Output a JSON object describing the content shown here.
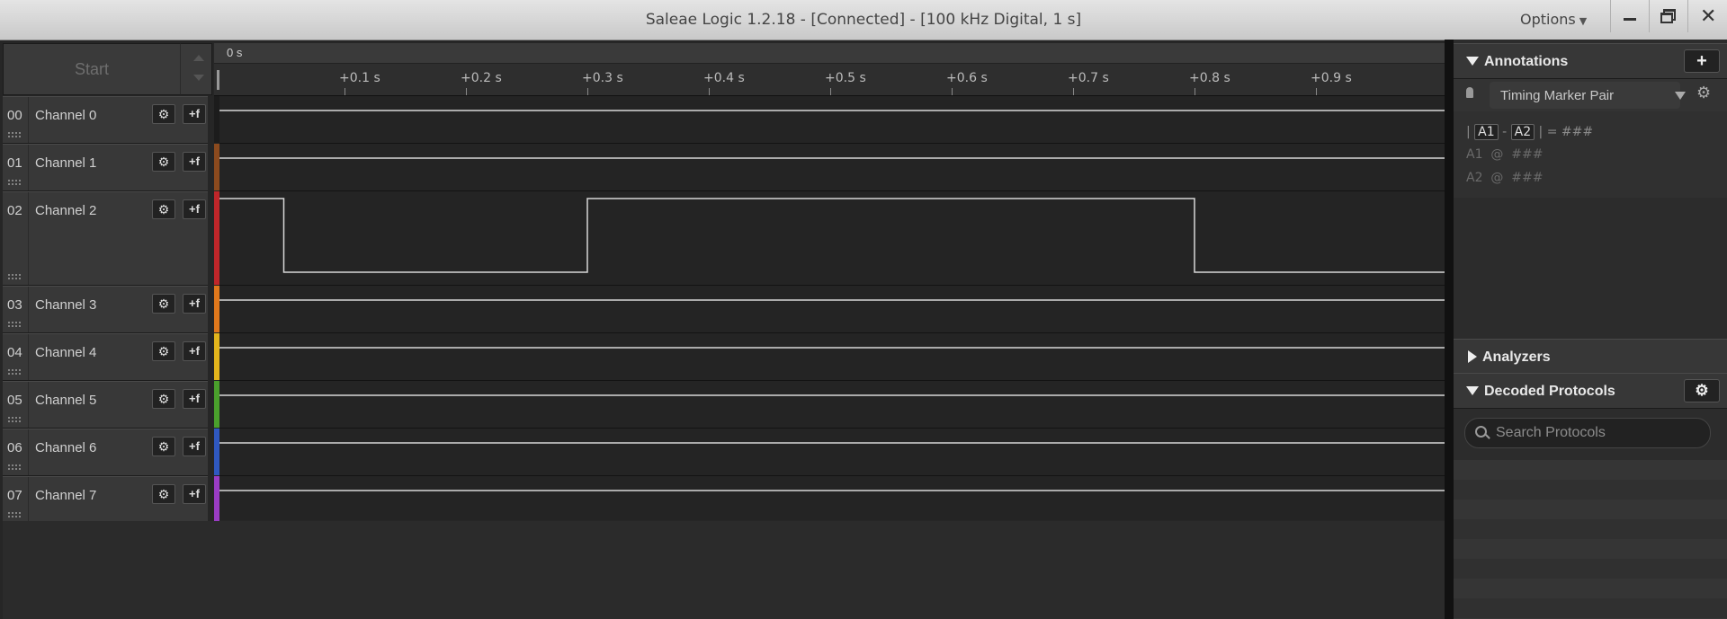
{
  "window": {
    "title": "Saleae Logic 1.2.18 - [Connected] - [100 kHz Digital, 1 s]",
    "options_label": "Options",
    "close_glyph": "✕"
  },
  "capture": {
    "start_label": "Start"
  },
  "timeline": {
    "origin_label": "0 s",
    "ticks": [
      "+0.1 s",
      "+0.2 s",
      "+0.3 s",
      "+0.4 s",
      "+0.5 s",
      "+0.6 s",
      "+0.7 s",
      "+0.8 s",
      "+0.9 s"
    ]
  },
  "channels": [
    {
      "num": "00",
      "name": "Channel 0",
      "color": "#1c1c1c",
      "level": "high"
    },
    {
      "num": "01",
      "name": "Channel 1",
      "color": "#8b4a1e",
      "level": "high"
    },
    {
      "num": "02",
      "name": "Channel 2",
      "color": "#c0262a",
      "level": "toggling"
    },
    {
      "num": "03",
      "name": "Channel 3",
      "color": "#e0781c",
      "level": "high"
    },
    {
      "num": "04",
      "name": "Channel 4",
      "color": "#e3b51c",
      "level": "high"
    },
    {
      "num": "05",
      "name": "Channel 5",
      "color": "#4aa02c",
      "level": "high"
    },
    {
      "num": "06",
      "name": "Channel 6",
      "color": "#2f58c0",
      "level": "high"
    },
    {
      "num": "07",
      "name": "Channel 7",
      "color": "#9a3cc4",
      "level": "high"
    }
  ],
  "channel2_transitions_s": [
    0.05,
    0.3,
    0.8
  ],
  "channel_button_icons": {
    "settings": "gear-icon",
    "trigger": "trigger-edge-icon",
    "trigger_glyph": "+f"
  },
  "annotations": {
    "title": "Annotations",
    "add_glyph": "+",
    "marker_pair_label": "Timing Marker Pair",
    "formula": {
      "a1": "A1",
      "dash": "-",
      "a2": "A2",
      "eq": "= ###"
    },
    "lines": [
      {
        "name": "A1",
        "at": "@",
        "value": "###"
      },
      {
        "name": "A2",
        "at": "@",
        "value": "###"
      }
    ]
  },
  "analyzers": {
    "title": "Analyzers"
  },
  "decoded_protocols": {
    "title": "Decoded Protocols",
    "search_placeholder": "Search Protocols"
  }
}
